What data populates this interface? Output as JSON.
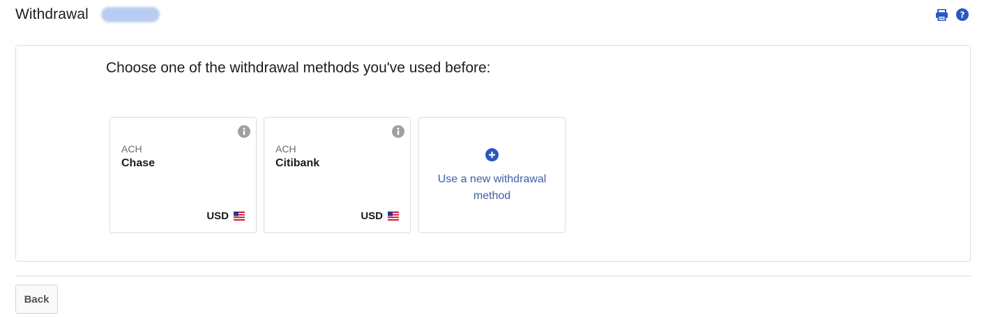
{
  "header": {
    "title": "Withdrawal",
    "account_chip": "",
    "actions": [
      {
        "icon": "printer-icon"
      },
      {
        "icon": "help-icon"
      }
    ]
  },
  "panel": {
    "heading": "Choose one of the withdrawal methods you've used before:",
    "methods": [
      {
        "type": "ACH",
        "name": "Chase",
        "currency": "USD",
        "flag": "us-flag-icon"
      },
      {
        "type": "ACH",
        "name": "Citibank",
        "currency": "USD",
        "flag": "us-flag-icon"
      }
    ],
    "new_method": {
      "label": "Use a new withdrawal method",
      "icon": "plus-circle-icon"
    }
  },
  "footer": {
    "back_label": "Back"
  },
  "colors": {
    "accent": "#2b57c4",
    "link_text": "#3f5ea8",
    "info_icon": "#a0a0a0",
    "border": "#dcdcdc"
  }
}
